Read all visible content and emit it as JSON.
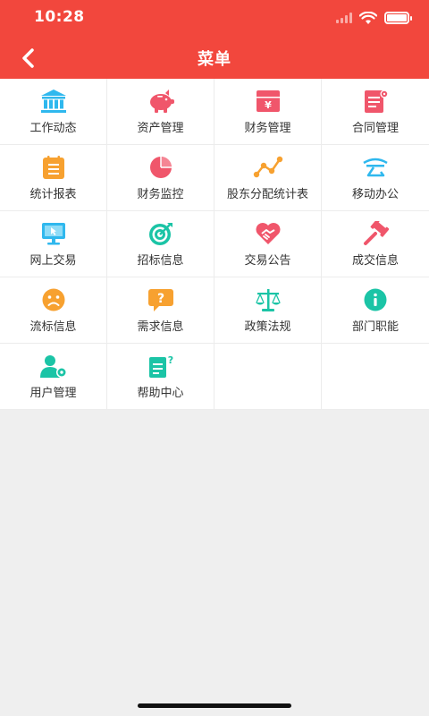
{
  "status_bar": {
    "time": "10:28"
  },
  "nav": {
    "title": "菜单",
    "back_icon": "chevron-left-icon"
  },
  "colors": {
    "header": "#f2473d"
  },
  "menu": {
    "items": [
      {
        "label": "工作动态",
        "icon": "bank-icon",
        "color": "#2fb8ee"
      },
      {
        "label": "资产管理",
        "icon": "piggy-bank-icon",
        "color": "#f0566b"
      },
      {
        "label": "财务管理",
        "icon": "yen-box-icon",
        "color": "#f0566b"
      },
      {
        "label": "合同管理",
        "icon": "contract-doc-icon",
        "color": "#f0566b"
      },
      {
        "label": "统计报表",
        "icon": "report-list-icon",
        "color": "#f7a130"
      },
      {
        "label": "财务监控",
        "icon": "pie-chart-icon",
        "color": "#f0566b"
      },
      {
        "label": "股东分配统计表",
        "icon": "trend-line-icon",
        "color": "#f7a130"
      },
      {
        "label": "移动办公",
        "icon": "cloud-text-icon",
        "color": "#2fb8ee"
      },
      {
        "label": "网上交易",
        "icon": "monitor-cursor-icon",
        "color": "#2fb8ee"
      },
      {
        "label": "招标信息",
        "icon": "target-icon",
        "color": "#1bc4a6"
      },
      {
        "label": "交易公告",
        "icon": "heart-handshake-icon",
        "color": "#f0566b"
      },
      {
        "label": "成交信息",
        "icon": "gavel-icon",
        "color": "#f0566b"
      },
      {
        "label": "流标信息",
        "icon": "sad-face-icon",
        "color": "#f7a130"
      },
      {
        "label": "需求信息",
        "icon": "question-bubble-icon",
        "color": "#f7a130"
      },
      {
        "label": "政策法规",
        "icon": "balance-scale-icon",
        "color": "#1bc4a6"
      },
      {
        "label": "部门职能",
        "icon": "info-circle-icon",
        "color": "#1bc4a6"
      },
      {
        "label": "用户管理",
        "icon": "user-gear-icon",
        "color": "#1bc4a6"
      },
      {
        "label": "帮助中心",
        "icon": "help-doc-icon",
        "color": "#1bc4a6"
      }
    ]
  }
}
